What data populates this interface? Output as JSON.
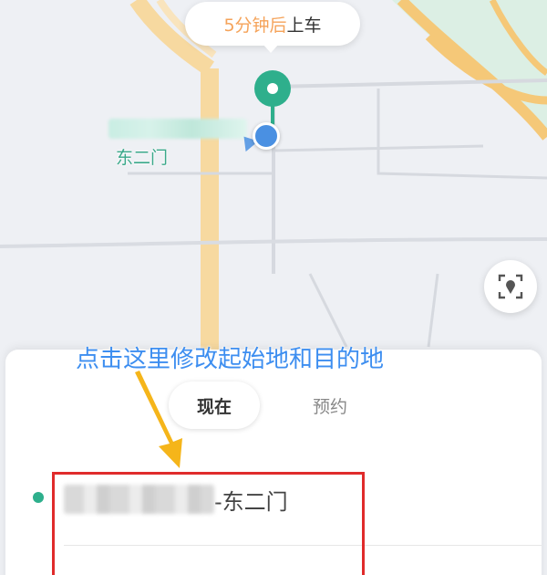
{
  "map": {
    "eta_time": "5分钟后",
    "eta_action": "上车",
    "poi_label": "东二门",
    "relocate_icon": "locate-target-icon"
  },
  "sheet": {
    "tabs": [
      {
        "label": "现在",
        "active": true
      },
      {
        "label": "预约",
        "active": false
      }
    ],
    "origin_suffix": "-东二门"
  },
  "annotation": {
    "text": "点击这里修改起始地和目的地",
    "color": "#3d8ef0",
    "arrow_color": "#f5b51a",
    "box_color": "#e02b2b"
  },
  "colors": {
    "accent_green": "#2eaf8c",
    "location_blue": "#4a90e2",
    "eta_orange": "#f5a35a"
  }
}
